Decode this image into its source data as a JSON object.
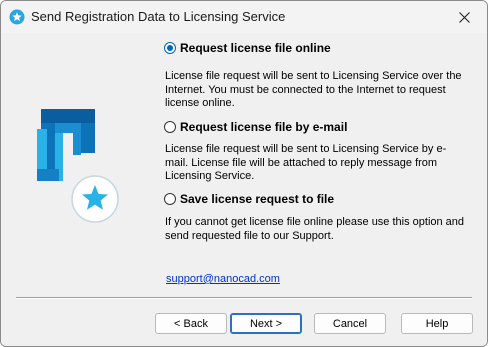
{
  "window": {
    "title": "Send Registration Data to Licensing Service",
    "title_icon": "star-app-icon",
    "close_glyph": "✕"
  },
  "options": [
    {
      "label": "Request license file online",
      "checked": true,
      "description": "License file request will be sent to Licensing Service over the Internet. You must be connected to the Internet to request license online."
    },
    {
      "label": "Request license file by e-mail",
      "checked": false,
      "description": "License file request will be sent to Licensing Service by e-mail. License file will be attached to reply message from Licensing Service."
    },
    {
      "label": "Save license request to file",
      "checked": false,
      "description": "If you cannot get license file online please use this option and send requested file to our Support."
    }
  ],
  "support_link": "support@nanocad.com",
  "buttons": {
    "back": "< Back",
    "next": "Next >",
    "cancel": "Cancel",
    "help": "Help"
  },
  "colors": {
    "accent": "#0067c0",
    "link": "#0033cc",
    "logo_dark": "#0a5d9e",
    "logo_light": "#29b2e8"
  }
}
